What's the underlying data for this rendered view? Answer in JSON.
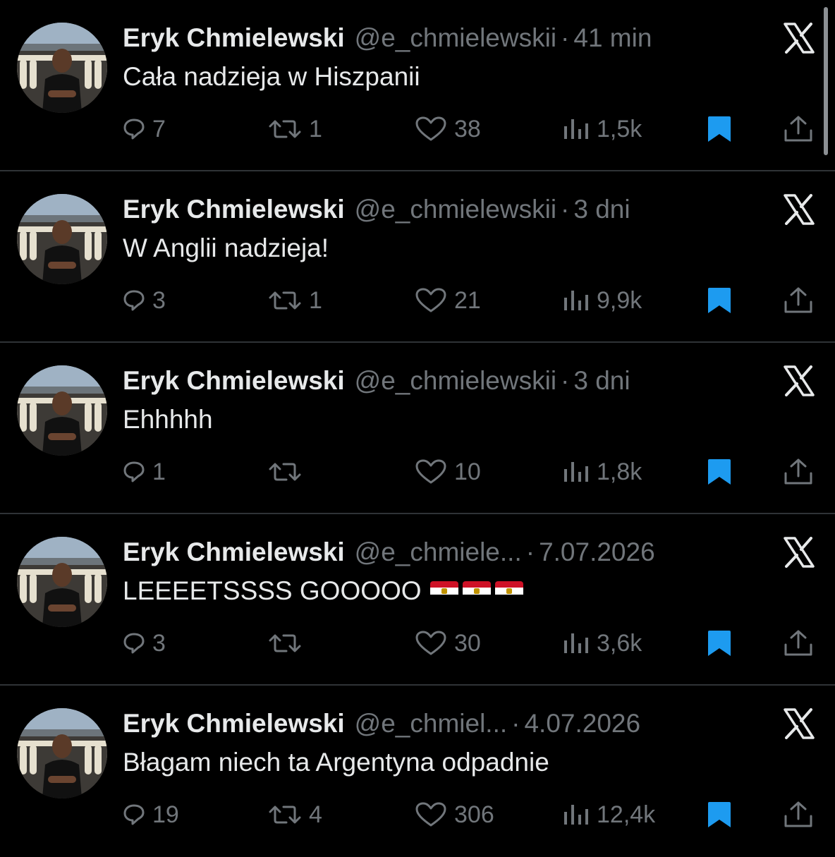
{
  "tweets": [
    {
      "name": "Eryk Chmielewski",
      "handle": "@e_chmielewskii",
      "separator": "·",
      "time": "41 min",
      "text": "Cała nadzieja w Hiszpanii",
      "replies": "7",
      "retweets": "1",
      "likes": "38",
      "views": "1,5k"
    },
    {
      "name": "Eryk Chmielewski",
      "handle": "@e_chmielewskii",
      "separator": "·",
      "time": "3 dni",
      "text": "W Anglii nadzieja!",
      "replies": "3",
      "retweets": "1",
      "likes": "21",
      "views": "9,9k"
    },
    {
      "name": "Eryk Chmielewski",
      "handle": "@e_chmielewskii",
      "separator": "·",
      "time": "3 dni",
      "text": "Ehhhhh",
      "replies": "1",
      "retweets": "",
      "likes": "10",
      "views": "1,8k"
    },
    {
      "name": "Eryk Chmielewski",
      "handle": "@e_chmiele...",
      "separator": "·",
      "time": "7.07.2026",
      "text": "LEEEETSSSS GOOOOO",
      "flags": [
        "egypt-flag",
        "egypt-flag",
        "egypt-flag"
      ],
      "replies": "3",
      "retweets": "",
      "likes": "30",
      "views": "3,6k"
    },
    {
      "name": "Eryk Chmielewski",
      "handle": "@e_chmiel...",
      "separator": "·",
      "time": "4.07.2026",
      "text": "Błagam niech ta Argentyna odpadnie",
      "replies": "19",
      "retweets": "4",
      "likes": "306",
      "views": "12,4k"
    }
  ],
  "colors": {
    "background": "#000000",
    "primary_text": "#e7e9ea",
    "secondary_text": "#71767b",
    "divider": "#2f3336",
    "bookmark_active": "#1d9bf0"
  },
  "icons": {
    "platform": "x-logo-icon",
    "reply": "reply-icon",
    "retweet": "retweet-icon",
    "like": "heart-icon",
    "views": "views-icon",
    "bookmark": "bookmark-filled-icon",
    "share": "share-icon"
  }
}
